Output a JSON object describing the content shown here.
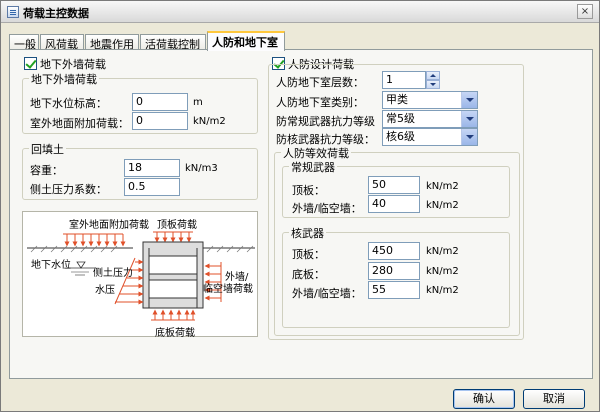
{
  "window": {
    "title": "荷载主控数据",
    "close": "×"
  },
  "tabs": [
    {
      "label": "一般"
    },
    {
      "label": "风荷载"
    },
    {
      "label": "地震作用"
    },
    {
      "label": "活荷载控制"
    },
    {
      "label": "人防和地下室"
    }
  ],
  "left": {
    "ext_wall_load": {
      "label": "地下外墙荷载",
      "outer_group_label": "地下外墙荷载",
      "water_level_label": "地下水位标高：",
      "water_level_value": "0",
      "water_level_unit": "m",
      "surface_load_label": "室外地面附加荷载：",
      "surface_load_value": "0",
      "surface_load_unit": "kN/m2"
    },
    "backfill": {
      "label": "回填土",
      "density_label": "容重：",
      "density_value": "18",
      "density_unit": "kN/m3",
      "pressure_label": "侧土压力系数：",
      "pressure_value": "0.5"
    },
    "diagram": {
      "surface_load": "室外地面附加荷载",
      "roof_load": "顶板荷载",
      "water_level": "地下水位",
      "soil_pressure": "侧土压力",
      "water_pressure": "水压",
      "ext_wall": "外墙/",
      "temp_wall": "临空墙荷载",
      "bottom_load": "底板荷载"
    }
  },
  "right": {
    "civil_defense": {
      "label": "人防设计荷载",
      "floors_label": "人防地下室层数：",
      "floors_value": "1",
      "type_label": "人防地下室类别：",
      "type_value": "甲类",
      "conv_level_label": "防常规武器抗力等级",
      "conv_level_value": "常5级",
      "nuke_level_label": "防核武器抗力等级：",
      "nuke_level_value": "核6级"
    },
    "equiv_load": {
      "label": "人防等效荷载",
      "conventional": {
        "label": "常规武器",
        "roof_label": "顶板：",
        "roof_value": "50",
        "roof_unit": "kN/m2",
        "wall_label": "外墙/临空墙：",
        "wall_value": "40",
        "wall_unit": "kN/m2"
      },
      "nuclear": {
        "label": "核武器",
        "roof_label": "顶板：",
        "roof_value": "450",
        "roof_unit": "kN/m2",
        "floor_label": "底板：",
        "floor_value": "280",
        "floor_unit": "kN/m2",
        "wall_label": "外墙/临空墙：",
        "wall_value": "55",
        "wall_unit": "kN/m2"
      }
    }
  },
  "buttons": {
    "ok": "确认",
    "cancel": "取消"
  },
  "colors": {
    "accent": "#ffc83c",
    "arrow": "#e0502a",
    "window_bg": "#ece9d8"
  }
}
